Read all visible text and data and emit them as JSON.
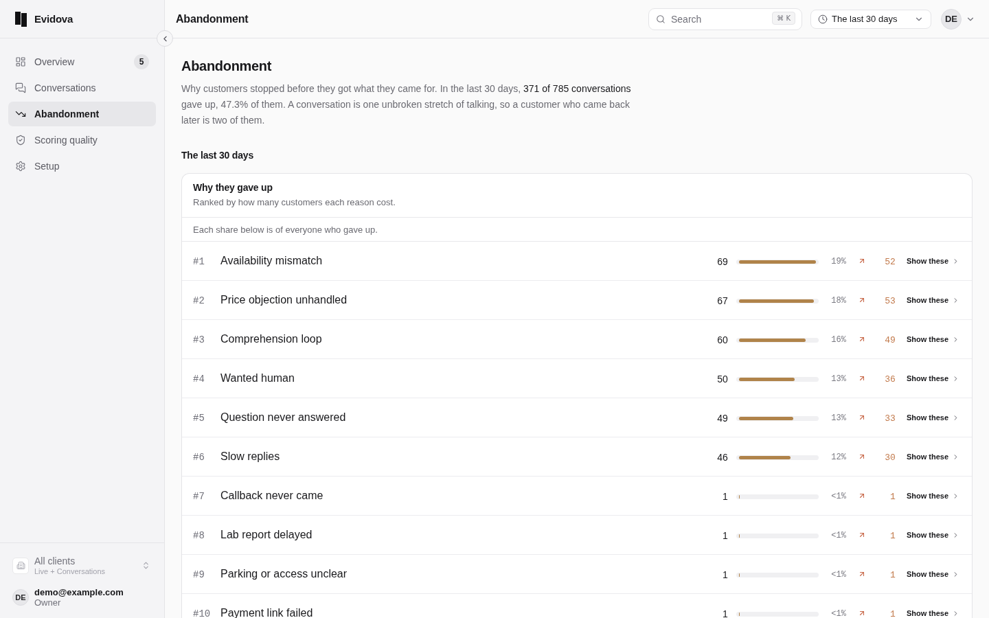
{
  "sidebar": {
    "brand": "Evidova",
    "nav": [
      {
        "label": "Overview",
        "badge": "5",
        "selected": false
      },
      {
        "label": "Conversations",
        "selected": false
      },
      {
        "label": "Abandonment",
        "selected": true
      },
      {
        "label": "Scoring quality",
        "selected": false
      },
      {
        "label": "Setup",
        "selected": false
      }
    ],
    "workspace": {
      "name": "All clients",
      "subtitle": "Live + Conversations"
    },
    "user": {
      "initials": "DE",
      "email": "demo@example.com",
      "role": "Owner"
    }
  },
  "header": {
    "title": "Abandonment",
    "search": {
      "placeholder": "Search",
      "shortcut": "⌘ K"
    },
    "date_range": "The last 30 days",
    "avatar": "DE"
  },
  "page": {
    "title": "Abandonment",
    "intro": "Why customers stopped before they got what they came for. In the last 30 days, **371 of 785 conversations** gave up, 47.3% of them. A conversation is one unbroken stretch of talking, so a customer who came back later is two of them.",
    "section_title": "The last 30 days",
    "card": {
      "title": "Why they gave up",
      "subtitle": "Ranked by how many customers each reason cost.",
      "note": "Each share below is of everyone who gave up.",
      "rows": [
        {
          "rank": "#1",
          "reason": "Availability mismatch",
          "count": "69",
          "level": 1.0,
          "share": "19%",
          "trend_count": "52",
          "action": "Show these"
        },
        {
          "rank": "#2",
          "reason": "Price objection unhandled",
          "count": "67",
          "level": 0.97,
          "share": "18%",
          "trend_count": "53",
          "action": "Show these"
        },
        {
          "rank": "#3",
          "reason": "Comprehension loop",
          "count": "60",
          "level": 0.87,
          "share": "16%",
          "trend_count": "49",
          "action": "Show these"
        },
        {
          "rank": "#4",
          "reason": "Wanted human",
          "count": "50",
          "level": 0.72,
          "share": "13%",
          "trend_count": "36",
          "action": "Show these"
        },
        {
          "rank": "#5",
          "reason": "Question never answered",
          "count": "49",
          "level": 0.71,
          "share": "13%",
          "trend_count": "33",
          "action": "Show these"
        },
        {
          "rank": "#6",
          "reason": "Slow replies",
          "count": "46",
          "level": 0.67,
          "share": "12%",
          "trend_count": "30",
          "action": "Show these"
        },
        {
          "rank": "#7",
          "reason": "Callback never came",
          "count": "1",
          "level": 0.01,
          "share": "<1%",
          "trend_count": "1",
          "action": "Show these"
        },
        {
          "rank": "#8",
          "reason": "Lab report delayed",
          "count": "1",
          "level": 0.01,
          "share": "<1%",
          "trend_count": "1",
          "action": "Show these"
        },
        {
          "rank": "#9",
          "reason": "Parking or access unclear",
          "count": "1",
          "level": 0.01,
          "share": "<1%",
          "trend_count": "1",
          "action": "Show these"
        },
        {
          "rank": "#10",
          "reason": "Payment link failed",
          "count": "1",
          "level": 0.01,
          "share": "<1%",
          "trend_count": "1",
          "action": "Show these"
        }
      ]
    }
  }
}
